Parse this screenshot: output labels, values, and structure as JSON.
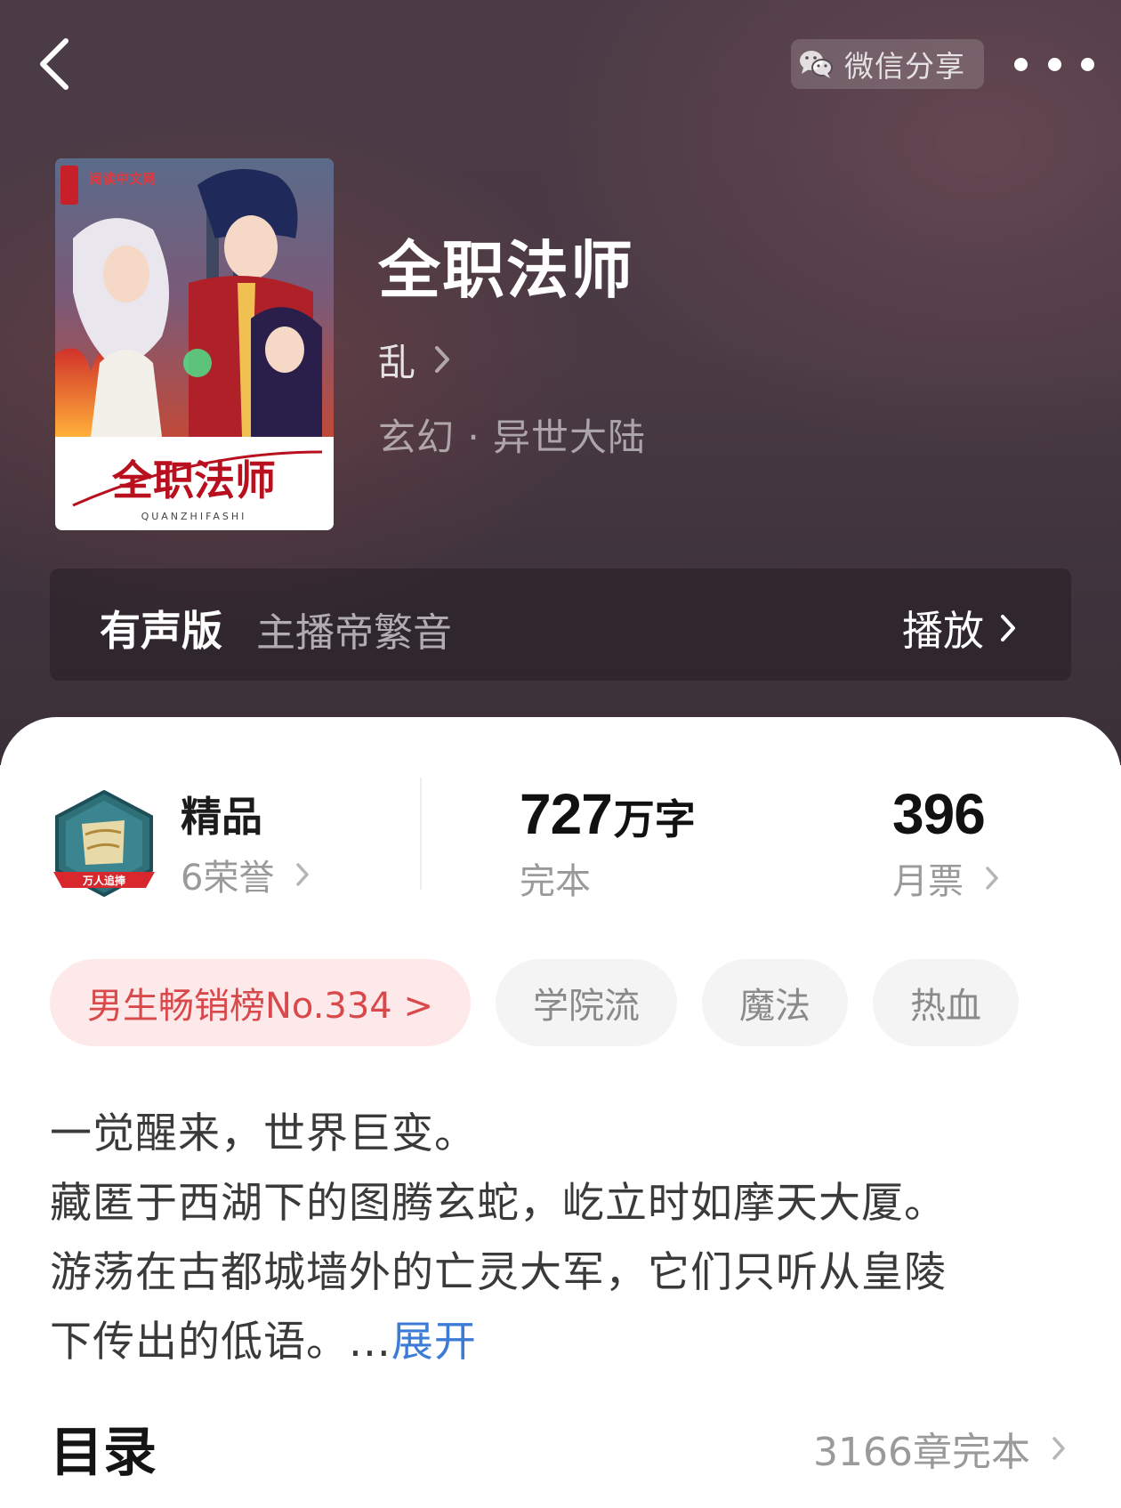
{
  "header": {
    "share_label": "微信分享"
  },
  "book": {
    "title": "全职法师",
    "author": "乱",
    "genre": "玄幻 · 异世大陆",
    "cover": {
      "publisher_logo": "阅读中文网",
      "title_art": "全职法师",
      "subtitle_art": "QUANZHIFASHI"
    }
  },
  "audio": {
    "label": "有声版",
    "narrator": "主播帝繁音",
    "play_label": "播放"
  },
  "stats": {
    "honor_title": "精品",
    "honor_count": "6荣誉",
    "badge_ribbon": "万人追捧",
    "word_count": "727",
    "word_unit": "万字",
    "status": "完本",
    "monthly_votes": "396",
    "monthly_votes_label": "月票"
  },
  "tags": {
    "rank": "男生畅销榜No.334 >",
    "tag1": "学院流",
    "tag2": "魔法",
    "tag3": "热血"
  },
  "synopsis": {
    "line1": "一觉醒来，世界巨变。",
    "line2": "藏匿于西湖下的图腾玄蛇，屹立时如摩天大厦。",
    "line3": "游荡在古都城墙外的亡灵大军，它们只听从皇陵",
    "line4": "下传出的低语。",
    "ellipsis": "...",
    "expand_label": "展开"
  },
  "toc": {
    "title": "目录",
    "chapter_info": "3166章完本"
  },
  "colors": {
    "header_bg": "#4a3a44",
    "rank_tag_bg": "#fde9e9",
    "rank_tag_text": "#d9484b",
    "link_blue": "#3c7bd6"
  }
}
